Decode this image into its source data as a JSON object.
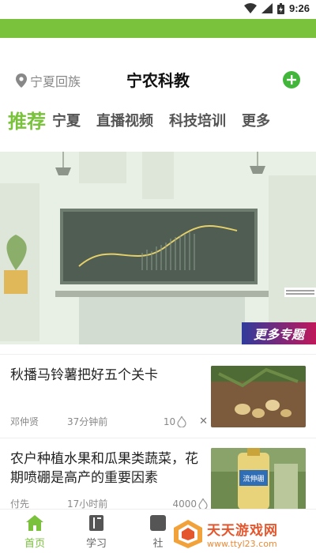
{
  "status_bar": {
    "time": "9:26"
  },
  "header": {
    "location": "宁夏回族",
    "title": "宁农科教"
  },
  "tabs": [
    {
      "label": "推荐"
    },
    {
      "label": "宁夏"
    },
    {
      "label": "直播视频"
    },
    {
      "label": "科技培训"
    },
    {
      "label": "更多"
    }
  ],
  "banner": {
    "tag": "更多专题"
  },
  "news": [
    {
      "title": "秋播马铃薯把好五个关卡",
      "author": "邓仲贤",
      "time": "37分钟前",
      "count": "10"
    },
    {
      "title": "农户种植水果和瓜果类蔬菜，花期喷硼是高产的重要因素",
      "author": "付先",
      "time": "17小时前",
      "count": "4000",
      "thumb_label": "流伸硼"
    }
  ],
  "bottom_nav": [
    {
      "label": "首页"
    },
    {
      "label": "学习"
    },
    {
      "label": "社"
    }
  ],
  "watermark": {
    "title": "天天游戏网",
    "url": "www.ttyl23.com"
  },
  "colors": {
    "accent": "#7ac23c",
    "add_button": "#41b63a"
  }
}
